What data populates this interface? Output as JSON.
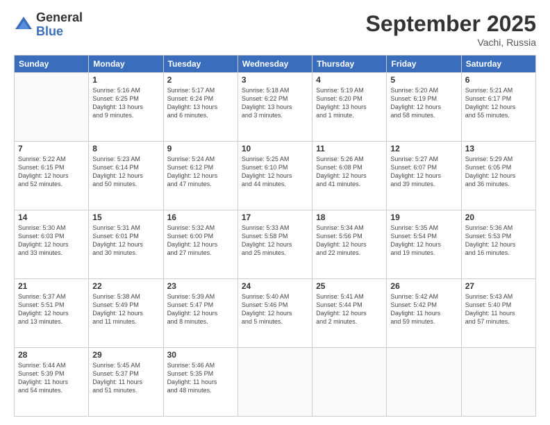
{
  "logo": {
    "general": "General",
    "blue": "Blue"
  },
  "title": "September 2025",
  "location": "Vachi, Russia",
  "headers": [
    "Sunday",
    "Monday",
    "Tuesday",
    "Wednesday",
    "Thursday",
    "Friday",
    "Saturday"
  ],
  "weeks": [
    [
      {
        "day": "",
        "info": ""
      },
      {
        "day": "1",
        "info": "Sunrise: 5:16 AM\nSunset: 6:25 PM\nDaylight: 13 hours\nand 9 minutes."
      },
      {
        "day": "2",
        "info": "Sunrise: 5:17 AM\nSunset: 6:24 PM\nDaylight: 13 hours\nand 6 minutes."
      },
      {
        "day": "3",
        "info": "Sunrise: 5:18 AM\nSunset: 6:22 PM\nDaylight: 13 hours\nand 3 minutes."
      },
      {
        "day": "4",
        "info": "Sunrise: 5:19 AM\nSunset: 6:20 PM\nDaylight: 13 hours\nand 1 minute."
      },
      {
        "day": "5",
        "info": "Sunrise: 5:20 AM\nSunset: 6:19 PM\nDaylight: 12 hours\nand 58 minutes."
      },
      {
        "day": "6",
        "info": "Sunrise: 5:21 AM\nSunset: 6:17 PM\nDaylight: 12 hours\nand 55 minutes."
      }
    ],
    [
      {
        "day": "7",
        "info": "Sunrise: 5:22 AM\nSunset: 6:15 PM\nDaylight: 12 hours\nand 52 minutes."
      },
      {
        "day": "8",
        "info": "Sunrise: 5:23 AM\nSunset: 6:14 PM\nDaylight: 12 hours\nand 50 minutes."
      },
      {
        "day": "9",
        "info": "Sunrise: 5:24 AM\nSunset: 6:12 PM\nDaylight: 12 hours\nand 47 minutes."
      },
      {
        "day": "10",
        "info": "Sunrise: 5:25 AM\nSunset: 6:10 PM\nDaylight: 12 hours\nand 44 minutes."
      },
      {
        "day": "11",
        "info": "Sunrise: 5:26 AM\nSunset: 6:08 PM\nDaylight: 12 hours\nand 41 minutes."
      },
      {
        "day": "12",
        "info": "Sunrise: 5:27 AM\nSunset: 6:07 PM\nDaylight: 12 hours\nand 39 minutes."
      },
      {
        "day": "13",
        "info": "Sunrise: 5:29 AM\nSunset: 6:05 PM\nDaylight: 12 hours\nand 36 minutes."
      }
    ],
    [
      {
        "day": "14",
        "info": "Sunrise: 5:30 AM\nSunset: 6:03 PM\nDaylight: 12 hours\nand 33 minutes."
      },
      {
        "day": "15",
        "info": "Sunrise: 5:31 AM\nSunset: 6:01 PM\nDaylight: 12 hours\nand 30 minutes."
      },
      {
        "day": "16",
        "info": "Sunrise: 5:32 AM\nSunset: 6:00 PM\nDaylight: 12 hours\nand 27 minutes."
      },
      {
        "day": "17",
        "info": "Sunrise: 5:33 AM\nSunset: 5:58 PM\nDaylight: 12 hours\nand 25 minutes."
      },
      {
        "day": "18",
        "info": "Sunrise: 5:34 AM\nSunset: 5:56 PM\nDaylight: 12 hours\nand 22 minutes."
      },
      {
        "day": "19",
        "info": "Sunrise: 5:35 AM\nSunset: 5:54 PM\nDaylight: 12 hours\nand 19 minutes."
      },
      {
        "day": "20",
        "info": "Sunrise: 5:36 AM\nSunset: 5:53 PM\nDaylight: 12 hours\nand 16 minutes."
      }
    ],
    [
      {
        "day": "21",
        "info": "Sunrise: 5:37 AM\nSunset: 5:51 PM\nDaylight: 12 hours\nand 13 minutes."
      },
      {
        "day": "22",
        "info": "Sunrise: 5:38 AM\nSunset: 5:49 PM\nDaylight: 12 hours\nand 11 minutes."
      },
      {
        "day": "23",
        "info": "Sunrise: 5:39 AM\nSunset: 5:47 PM\nDaylight: 12 hours\nand 8 minutes."
      },
      {
        "day": "24",
        "info": "Sunrise: 5:40 AM\nSunset: 5:46 PM\nDaylight: 12 hours\nand 5 minutes."
      },
      {
        "day": "25",
        "info": "Sunrise: 5:41 AM\nSunset: 5:44 PM\nDaylight: 12 hours\nand 2 minutes."
      },
      {
        "day": "26",
        "info": "Sunrise: 5:42 AM\nSunset: 5:42 PM\nDaylight: 11 hours\nand 59 minutes."
      },
      {
        "day": "27",
        "info": "Sunrise: 5:43 AM\nSunset: 5:40 PM\nDaylight: 11 hours\nand 57 minutes."
      }
    ],
    [
      {
        "day": "28",
        "info": "Sunrise: 5:44 AM\nSunset: 5:39 PM\nDaylight: 11 hours\nand 54 minutes."
      },
      {
        "day": "29",
        "info": "Sunrise: 5:45 AM\nSunset: 5:37 PM\nDaylight: 11 hours\nand 51 minutes."
      },
      {
        "day": "30",
        "info": "Sunrise: 5:46 AM\nSunset: 5:35 PM\nDaylight: 11 hours\nand 48 minutes."
      },
      {
        "day": "",
        "info": ""
      },
      {
        "day": "",
        "info": ""
      },
      {
        "day": "",
        "info": ""
      },
      {
        "day": "",
        "info": ""
      }
    ]
  ]
}
